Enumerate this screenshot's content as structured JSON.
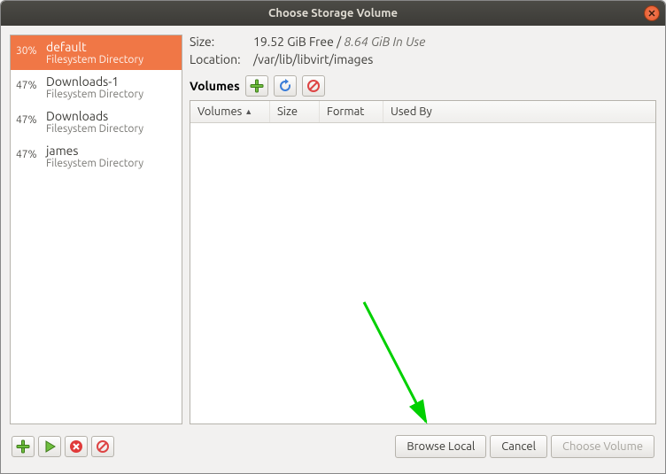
{
  "title": "Choose Storage Volume",
  "pools": [
    {
      "pct": "30%",
      "name": "default",
      "sub": "Filesystem Directory"
    },
    {
      "pct": "47%",
      "name": "Downloads-1",
      "sub": "Filesystem Directory"
    },
    {
      "pct": "47%",
      "name": "Downloads",
      "sub": "Filesystem Directory"
    },
    {
      "pct": "47%",
      "name": "james",
      "sub": "Filesystem Directory"
    }
  ],
  "info": {
    "size_label": "Size:",
    "size_free": "19.52 GiB Free",
    "size_sep": " / ",
    "size_used": "8.64 GiB In Use",
    "loc_label": "Location:",
    "loc_value": "/var/lib/libvirt/images"
  },
  "volumes_label": "Volumes",
  "columns": {
    "volumes": "Volumes",
    "size": "Size",
    "format": "Format",
    "usedby": "Used By"
  },
  "buttons": {
    "browse": "Browse Local",
    "cancel": "Cancel",
    "choose": "Choose Volume"
  }
}
